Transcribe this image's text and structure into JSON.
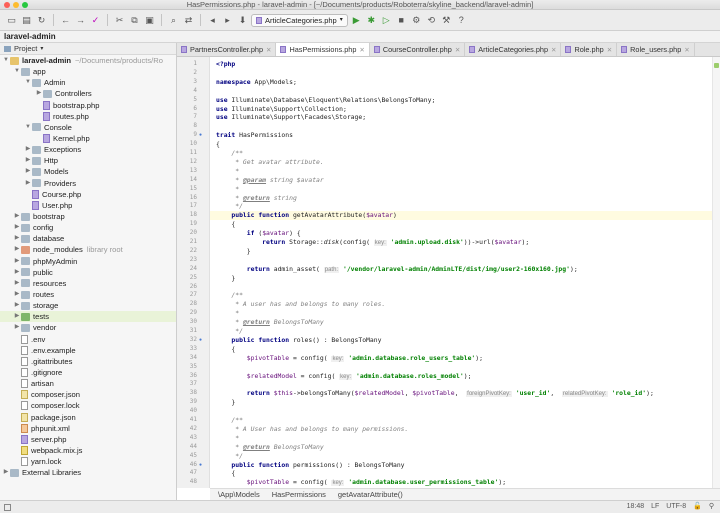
{
  "window": {
    "title": "HasPermissions.php - laravel-admin - [~/Documents/products/Roboterra/skyline_backend/laravel-admin]"
  },
  "toolbar": {
    "run_config": "ArticleCategories.php"
  },
  "navbar": {
    "project": "laravel-admin"
  },
  "sidebar": {
    "header": "Project",
    "items": [
      {
        "label": "laravel-admin",
        "hint": "~/Documents/products/Ro",
        "depth": 0,
        "arrow": "open",
        "icon": "folder",
        "bold": true
      },
      {
        "label": "app",
        "depth": 1,
        "arrow": "open",
        "icon": "folder"
      },
      {
        "label": "Admin",
        "depth": 2,
        "arrow": "open",
        "icon": "folder"
      },
      {
        "label": "Controllers",
        "depth": 3,
        "arrow": "closed",
        "icon": "folder"
      },
      {
        "label": "bootstrap.php",
        "depth": 3,
        "arrow": "",
        "icon": "php"
      },
      {
        "label": "routes.php",
        "depth": 3,
        "arrow": "",
        "icon": "php"
      },
      {
        "label": "Console",
        "depth": 2,
        "arrow": "open",
        "icon": "folder"
      },
      {
        "label": "Kernel.php",
        "depth": 3,
        "arrow": "",
        "icon": "php"
      },
      {
        "label": "Exceptions",
        "depth": 2,
        "arrow": "closed",
        "icon": "folder"
      },
      {
        "label": "Http",
        "depth": 2,
        "arrow": "closed",
        "icon": "folder"
      },
      {
        "label": "Models",
        "depth": 2,
        "arrow": "closed",
        "icon": "folder"
      },
      {
        "label": "Providers",
        "depth": 2,
        "arrow": "closed",
        "icon": "folder"
      },
      {
        "label": "Course.php",
        "depth": 2,
        "arrow": "",
        "icon": "php"
      },
      {
        "label": "User.php",
        "depth": 2,
        "arrow": "",
        "icon": "php"
      },
      {
        "label": "bootstrap",
        "depth": 1,
        "arrow": "closed",
        "icon": "folder"
      },
      {
        "label": "config",
        "depth": 1,
        "arrow": "closed",
        "icon": "folder"
      },
      {
        "label": "database",
        "depth": 1,
        "arrow": "closed",
        "icon": "folder"
      },
      {
        "label": "node_modules",
        "hint": "library root",
        "depth": 1,
        "arrow": "closed",
        "icon": "excluded"
      },
      {
        "label": "phpMyAdmin",
        "depth": 1,
        "arrow": "closed",
        "icon": "folder"
      },
      {
        "label": "public",
        "depth": 1,
        "arrow": "closed",
        "icon": "folder"
      },
      {
        "label": "resources",
        "depth": 1,
        "arrow": "closed",
        "icon": "folder"
      },
      {
        "label": "routes",
        "depth": 1,
        "arrow": "closed",
        "icon": "folder"
      },
      {
        "label": "storage",
        "depth": 1,
        "arrow": "closed",
        "icon": "folder"
      },
      {
        "label": "tests",
        "depth": 1,
        "arrow": "closed",
        "icon": "test",
        "highlight": true
      },
      {
        "label": "vendor",
        "depth": 1,
        "arrow": "closed",
        "icon": "folder"
      },
      {
        "label": ".env",
        "depth": 1,
        "arrow": "",
        "icon": "file"
      },
      {
        "label": ".env.example",
        "depth": 1,
        "arrow": "",
        "icon": "file"
      },
      {
        "label": ".gitattributes",
        "depth": 1,
        "arrow": "",
        "icon": "file"
      },
      {
        "label": ".gitignore",
        "depth": 1,
        "arrow": "",
        "icon": "file"
      },
      {
        "label": "artisan",
        "depth": 1,
        "arrow": "",
        "icon": "file"
      },
      {
        "label": "composer.json",
        "depth": 1,
        "arrow": "",
        "icon": "json"
      },
      {
        "label": "composer.lock",
        "depth": 1,
        "arrow": "",
        "icon": "file"
      },
      {
        "label": "package.json",
        "depth": 1,
        "arrow": "",
        "icon": "json"
      },
      {
        "label": "phpunit.xml",
        "depth": 1,
        "arrow": "",
        "icon": "xml"
      },
      {
        "label": "server.php",
        "depth": 1,
        "arrow": "",
        "icon": "php"
      },
      {
        "label": "webpack.mix.js",
        "depth": 1,
        "arrow": "",
        "icon": "js"
      },
      {
        "label": "yarn.lock",
        "depth": 1,
        "arrow": "",
        "icon": "file"
      },
      {
        "label": "External Libraries",
        "depth": 0,
        "arrow": "closed",
        "icon": "lib"
      }
    ]
  },
  "tabs": [
    {
      "label": "PartnersController.php",
      "active": false
    },
    {
      "label": "HasPermissions.php",
      "active": true
    },
    {
      "label": "CourseController.php",
      "active": false
    },
    {
      "label": "ArticleCategories.php",
      "active": false
    },
    {
      "label": "Role.php",
      "active": false
    },
    {
      "label": "Role_users.php",
      "active": false
    }
  ],
  "editor": {
    "current_line": 18,
    "lines": [
      {
        "n": 1,
        "html": "<span class=\"kw\">&lt;?php</span>"
      },
      {
        "n": 2,
        "html": ""
      },
      {
        "n": 3,
        "html": "<span class=\"kw\">namespace</span> App\\Models;"
      },
      {
        "n": 4,
        "html": ""
      },
      {
        "n": 5,
        "html": "<span class=\"kw\">use</span> Illuminate\\Database\\Eloquent\\Relations\\BelongsToMany;"
      },
      {
        "n": 6,
        "html": "<span class=\"kw\">use</span> Illuminate\\Support\\Collection;"
      },
      {
        "n": 7,
        "html": "<span class=\"kw\">use</span> Illuminate\\Support\\Facades\\Storage;"
      },
      {
        "n": 8,
        "html": ""
      },
      {
        "n": 9,
        "html": "<span class=\"kw\">trait</span> HasPermissions"
      },
      {
        "n": 10,
        "html": "{"
      },
      {
        "n": 11,
        "html": "    <span class=\"cm\">/**</span>"
      },
      {
        "n": 12,
        "html": "<span class=\"cm\">     * Get avatar attribute.</span>"
      },
      {
        "n": 13,
        "html": "<span class=\"cm\">     *</span>"
      },
      {
        "n": 14,
        "html": "<span class=\"cm\">     * </span><span class=\"tag\">@param</span><span class=\"cm\"> string $avatar</span>"
      },
      {
        "n": 15,
        "html": "<span class=\"cm\">     *</span>"
      },
      {
        "n": 16,
        "html": "<span class=\"cm\">     * </span><span class=\"tag\">@return</span><span class=\"cm\"> string</span>"
      },
      {
        "n": 17,
        "html": "<span class=\"cm\">     */</span>"
      },
      {
        "n": 18,
        "html": "    <span class=\"kw\">public function</span> getAvatarAttribute(<span class=\"var\">$avatar</span>)"
      },
      {
        "n": 19,
        "html": "    {"
      },
      {
        "n": 20,
        "html": "        <span class=\"kw\">if</span> (<span class=\"var\">$avatar</span>) {"
      },
      {
        "n": 21,
        "html": "            <span class=\"kw\">return</span> Storage::<span class=\"fn\">disk</span>(config( <span class=\"hintp\">key:</span> <span class=\"str\">'admin.upload.disk'</span>))-&gt;url(<span class=\"var\">$avatar</span>);"
      },
      {
        "n": 22,
        "html": "        }"
      },
      {
        "n": 23,
        "html": ""
      },
      {
        "n": 24,
        "html": "        <span class=\"kw\">return</span> admin_asset( <span class=\"hintp\">path:</span> <span class=\"str\">'/vendor/laravel-admin/AdminLTE/dist/img/user2-160x160.jpg'</span>);"
      },
      {
        "n": 25,
        "html": "    }"
      },
      {
        "n": 26,
        "html": ""
      },
      {
        "n": 27,
        "html": "    <span class=\"cm\">/**</span>"
      },
      {
        "n": 28,
        "html": "<span class=\"cm\">     * A user has and belongs to many roles.</span>"
      },
      {
        "n": 29,
        "html": "<span class=\"cm\">     *</span>"
      },
      {
        "n": 30,
        "html": "<span class=\"cm\">     * </span><span class=\"tag\">@return</span><span class=\"cm\"> BelongsToMany</span>"
      },
      {
        "n": 31,
        "html": "<span class=\"cm\">     */</span>"
      },
      {
        "n": 32,
        "html": "    <span class=\"kw\">public function</span> roles() : BelongsToMany"
      },
      {
        "n": 33,
        "html": "    {"
      },
      {
        "n": 34,
        "html": "        <span class=\"var\">$pivotTable</span> = config( <span class=\"hintp\">key:</span> <span class=\"str\">'admin.database.role_users_table'</span>);"
      },
      {
        "n": 35,
        "html": ""
      },
      {
        "n": 36,
        "html": "        <span class=\"var\">$relatedModel</span> = config( <span class=\"hintp\">key:</span> <span class=\"str\">'admin.database.roles_model'</span>);"
      },
      {
        "n": 37,
        "html": ""
      },
      {
        "n": 38,
        "html": "        <span class=\"kw\">return</span> <span class=\"var\">$this</span>-&gt;belongsToMany(<span class=\"var\">$relatedModel</span>, <span class=\"var\">$pivotTable</span>,  <span class=\"hintp\">foreignPivotKey:</span> <span class=\"str\">'user_id'</span>,  <span class=\"hintp\">relatedPivotKey:</span> <span class=\"str\">'role_id'</span>);"
      },
      {
        "n": 39,
        "html": "    }"
      },
      {
        "n": 40,
        "html": ""
      },
      {
        "n": 41,
        "html": "    <span class=\"cm\">/**</span>"
      },
      {
        "n": 42,
        "html": "<span class=\"cm\">     * A User has and belongs to many permissions.</span>"
      },
      {
        "n": 43,
        "html": "<span class=\"cm\">     *</span>"
      },
      {
        "n": 44,
        "html": "<span class=\"cm\">     * </span><span class=\"tag\">@return</span><span class=\"cm\"> BelongsToMany</span>"
      },
      {
        "n": 45,
        "html": "<span class=\"cm\">     */</span>"
      },
      {
        "n": 46,
        "html": "    <span class=\"kw\">public function</span> permissions() : BelongsToMany"
      },
      {
        "n": 47,
        "html": "    {"
      },
      {
        "n": 48,
        "html": "        <span class=\"var\">$pivotTable</span> = config( <span class=\"hintp\">key:</span> <span class=\"str\">'admin.database.user_permissions_table'</span>);"
      }
    ]
  },
  "breadcrumb": [
    "\\App\\Models",
    "HasPermissions",
    "getAvatarAttribute()"
  ],
  "status": {
    "position": "18:48",
    "line_sep": "LF",
    "encoding": "UTF-8"
  }
}
